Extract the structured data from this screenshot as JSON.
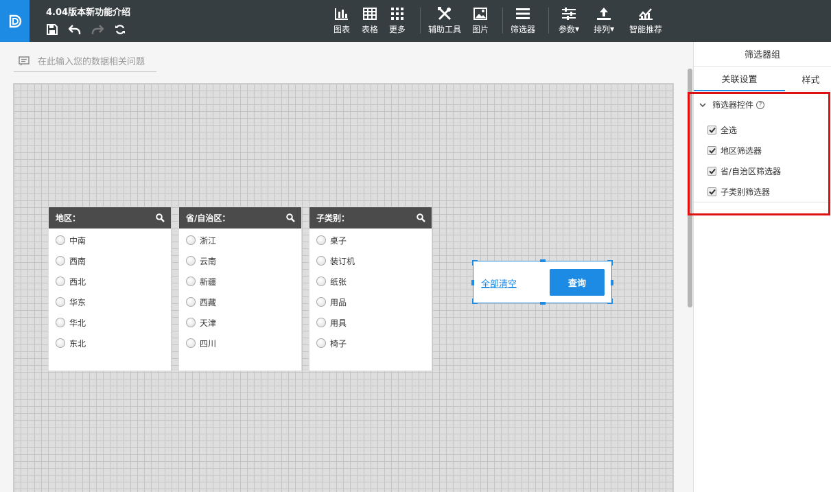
{
  "header": {
    "title": "4.04版本新功能介绍",
    "tools": [
      {
        "label": "图表",
        "icon": "bar-chart-icon"
      },
      {
        "label": "表格",
        "icon": "table-icon"
      },
      {
        "label": "更多",
        "icon": "grid-more-icon"
      },
      {
        "label": "辅助工具",
        "icon": "tools-icon"
      },
      {
        "label": "图片",
        "icon": "image-icon"
      },
      {
        "label": "筛选器",
        "icon": "filter-list-icon"
      },
      {
        "label": "参数",
        "icon": "sliders-icon"
      },
      {
        "label": "排列",
        "icon": "arrange-icon"
      },
      {
        "label": "智能推荐",
        "icon": "smart-chart-icon"
      }
    ],
    "quick_icons": [
      "save-icon",
      "undo-icon",
      "redo-icon",
      "refresh-icon"
    ]
  },
  "question_bar": {
    "placeholder": "在此输入您的数据相关问题"
  },
  "filters": [
    {
      "title": "地区：",
      "items": [
        "中南",
        "西南",
        "西北",
        "华东",
        "华北",
        "东北"
      ]
    },
    {
      "title": "省/自治区：",
      "items": [
        "浙江",
        "云南",
        "新疆",
        "西藏",
        "天津",
        "四川"
      ]
    },
    {
      "title": "子类别：",
      "items": [
        "桌子",
        "装订机",
        "纸张",
        "用品",
        "用具",
        "椅子"
      ]
    }
  ],
  "button_group": {
    "clear_label": "全部清空",
    "query_label": "查询"
  },
  "right_panel": {
    "title": "筛选器组",
    "tabs": [
      "关联设置",
      "样式"
    ],
    "section_title": "筛选器控件",
    "checkboxes": [
      {
        "label": "全选",
        "checked": true
      },
      {
        "label": "地区筛选器",
        "checked": true
      },
      {
        "label": "省/自治区筛选器",
        "checked": true
      },
      {
        "label": "子类别筛选器",
        "checked": true
      }
    ]
  },
  "colors": {
    "accent": "#1d8ae4",
    "topbar": "#373e41",
    "highlight": "#e01010"
  }
}
